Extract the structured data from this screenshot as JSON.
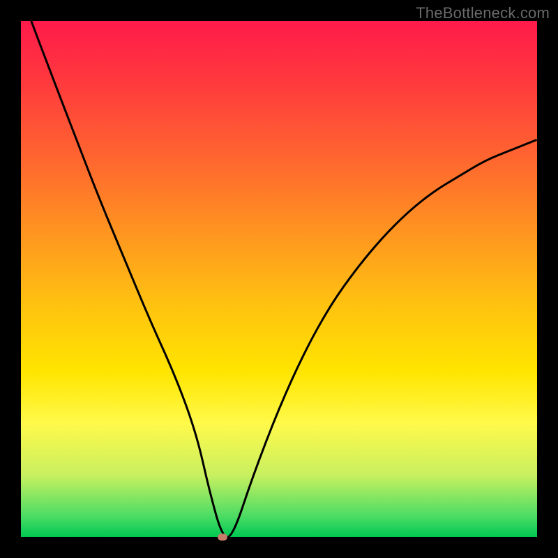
{
  "watermark": "TheBottleneck.com",
  "chart_data": {
    "type": "line",
    "title": "",
    "xlabel": "",
    "ylabel": "",
    "xlim": [
      0,
      100
    ],
    "ylim": [
      0,
      100
    ],
    "grid": false,
    "legend": false,
    "annotation_marker": {
      "x": 39,
      "y": 0,
      "color": "#c77b6a"
    },
    "series": [
      {
        "name": "curve",
        "color": "#000000",
        "x": [
          2,
          5,
          10,
          15,
          20,
          25,
          30,
          34,
          36.5,
          39,
          41,
          45,
          50,
          55,
          60,
          65,
          70,
          75,
          80,
          85,
          90,
          95,
          100
        ],
        "values": [
          100,
          92,
          79,
          66,
          54,
          42,
          31,
          20,
          9,
          0,
          0,
          12,
          25,
          36,
          45,
          52,
          58,
          63,
          67,
          70,
          73,
          75,
          77
        ]
      }
    ]
  }
}
